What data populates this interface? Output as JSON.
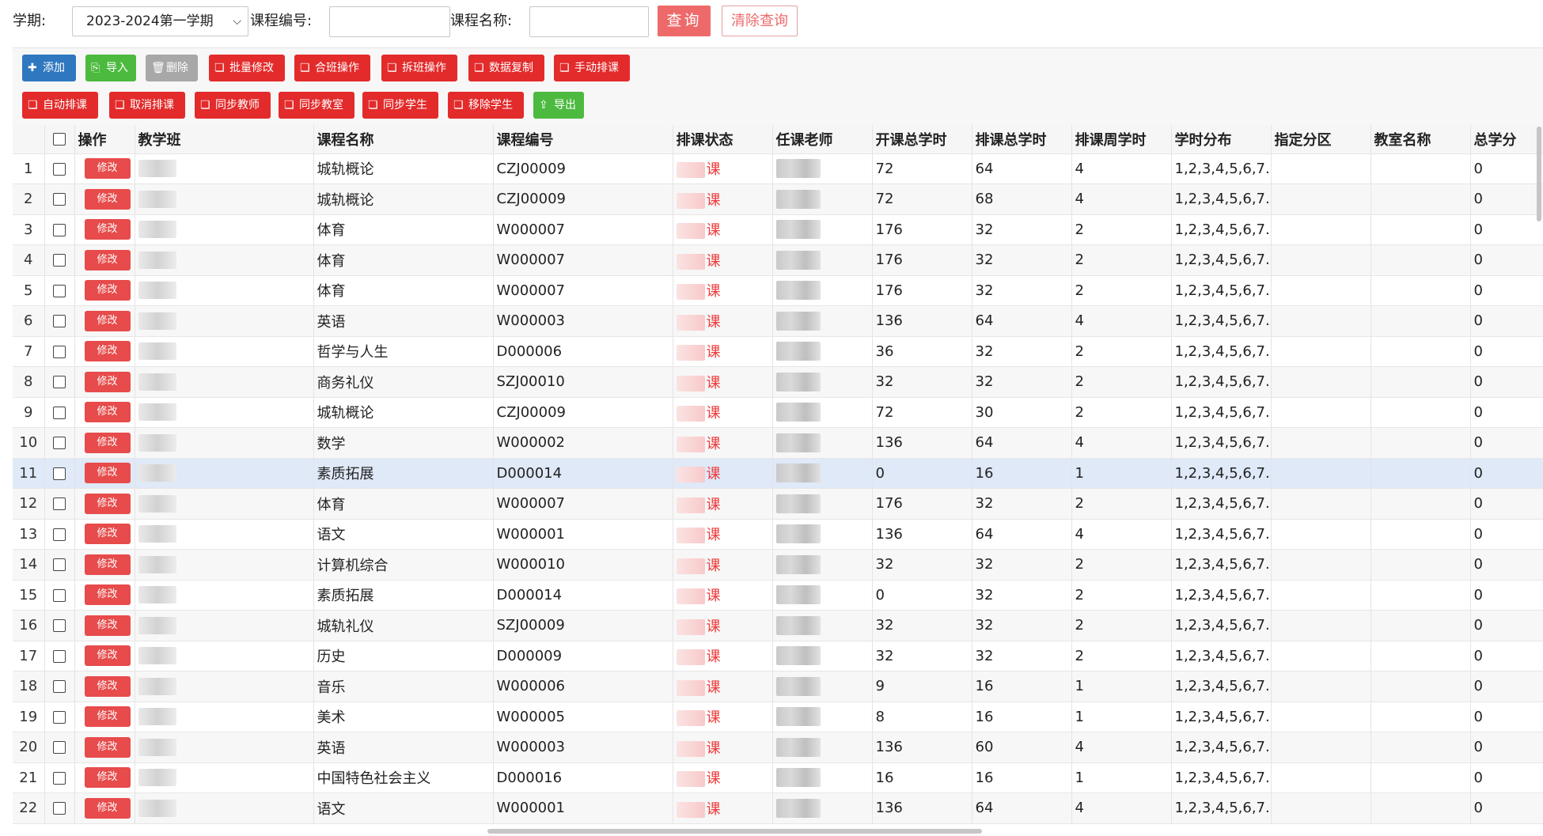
{
  "search": {
    "term_label": "学期:",
    "term_value": "2023-2024第一学期",
    "course_code_label": "课程编号:",
    "course_code_value": "",
    "course_name_label": "课程名称:",
    "course_name_value": "",
    "query_button": "查询",
    "clear_button": "清除查询"
  },
  "toolbar": {
    "row1": [
      {
        "label": "添加",
        "color": "blue",
        "icon": "plus-icon"
      },
      {
        "label": "导入",
        "color": "green",
        "icon": "import-icon"
      },
      {
        "label": "删除",
        "color": "gray",
        "icon": "trash-icon"
      },
      {
        "label": "批量修改",
        "color": "red",
        "icon": "book-icon"
      },
      {
        "label": "合班操作",
        "color": "red",
        "icon": "book-icon"
      },
      {
        "label": "拆班操作",
        "color": "red",
        "icon": "book-icon"
      },
      {
        "label": "数据复制",
        "color": "red",
        "icon": "book-icon"
      },
      {
        "label": "手动排课",
        "color": "red",
        "icon": "book-icon"
      }
    ],
    "row2": [
      {
        "label": "自动排课",
        "color": "red",
        "icon": "book-icon"
      },
      {
        "label": "取消排课",
        "color": "red",
        "icon": "book-icon"
      },
      {
        "label": "同步教师",
        "color": "red",
        "icon": "book-icon"
      },
      {
        "label": "同步教室",
        "color": "red",
        "icon": "book-icon"
      },
      {
        "label": "同步学生",
        "color": "red",
        "icon": "book-icon"
      },
      {
        "label": "移除学生",
        "color": "red",
        "icon": "book-icon"
      },
      {
        "label": "导出",
        "color": "green",
        "icon": "export-icon"
      }
    ]
  },
  "table": {
    "columns": [
      "操作",
      "教学班",
      "课程名称",
      "课程编号",
      "排课状态",
      "任课老师",
      "开课总学时",
      "排课总学时",
      "排课周学时",
      "学时分布",
      "指定分区",
      "教室名称",
      "总学分"
    ],
    "edit_label": "修改",
    "status_suffix": "课",
    "selected_row": 11,
    "rows": [
      {
        "no": "1",
        "course": "城轨概论",
        "code": "CZJ00009",
        "total": "72",
        "sched": "64",
        "weekly": "4",
        "dist": "1,2,3,4,5,6,7...",
        "credit": "0"
      },
      {
        "no": "2",
        "course": "城轨概论",
        "code": "CZJ00009",
        "total": "72",
        "sched": "68",
        "weekly": "4",
        "dist": "1,2,3,4,5,6,7...",
        "credit": "0"
      },
      {
        "no": "3",
        "course": "体育",
        "code": "W000007",
        "total": "176",
        "sched": "32",
        "weekly": "2",
        "dist": "1,2,3,4,5,6,7...",
        "credit": "0"
      },
      {
        "no": "4",
        "course": "体育",
        "code": "W000007",
        "total": "176",
        "sched": "32",
        "weekly": "2",
        "dist": "1,2,3,4,5,6,7...",
        "credit": "0"
      },
      {
        "no": "5",
        "course": "体育",
        "code": "W000007",
        "total": "176",
        "sched": "32",
        "weekly": "2",
        "dist": "1,2,3,4,5,6,7...",
        "credit": "0"
      },
      {
        "no": "6",
        "course": "英语",
        "code": "W000003",
        "total": "136",
        "sched": "64",
        "weekly": "4",
        "dist": "1,2,3,4,5,6,7...",
        "credit": "0"
      },
      {
        "no": "7",
        "course": "哲学与人生",
        "code": "D000006",
        "total": "36",
        "sched": "32",
        "weekly": "2",
        "dist": "1,2,3,4,5,6,7...",
        "credit": "0"
      },
      {
        "no": "8",
        "course": "商务礼仪",
        "code": "SZJ00010",
        "total": "32",
        "sched": "32",
        "weekly": "2",
        "dist": "1,2,3,4,5,6,7...",
        "credit": "0"
      },
      {
        "no": "9",
        "course": "城轨概论",
        "code": "CZJ00009",
        "total": "72",
        "sched": "30",
        "weekly": "2",
        "dist": "1,2,3,4,5,6,7...",
        "credit": "0"
      },
      {
        "no": "10",
        "course": "数学",
        "code": "W000002",
        "total": "136",
        "sched": "64",
        "weekly": "4",
        "dist": "1,2,3,4,5,6,7...",
        "credit": "0"
      },
      {
        "no": "11",
        "course": "素质拓展",
        "code": "D000014",
        "total": "0",
        "sched": "16",
        "weekly": "1",
        "dist": "1,2,3,4,5,6,7...",
        "credit": "0"
      },
      {
        "no": "12",
        "course": "体育",
        "code": "W000007",
        "total": "176",
        "sched": "32",
        "weekly": "2",
        "dist": "1,2,3,4,5,6,7...",
        "credit": "0"
      },
      {
        "no": "13",
        "course": "语文",
        "code": "W000001",
        "total": "136",
        "sched": "64",
        "weekly": "4",
        "dist": "1,2,3,4,5,6,7...",
        "credit": "0"
      },
      {
        "no": "14",
        "course": "计算机综合",
        "code": "W000010",
        "total": "32",
        "sched": "32",
        "weekly": "2",
        "dist": "1,2,3,4,5,6,7...",
        "credit": "0"
      },
      {
        "no": "15",
        "course": "素质拓展",
        "code": "D000014",
        "total": "0",
        "sched": "32",
        "weekly": "2",
        "dist": "1,2,3,4,5,6,7...",
        "credit": "0"
      },
      {
        "no": "16",
        "course": "城轨礼仪",
        "code": "SZJ00009",
        "total": "32",
        "sched": "32",
        "weekly": "2",
        "dist": "1,2,3,4,5,6,7...",
        "credit": "0"
      },
      {
        "no": "17",
        "course": "历史",
        "code": "D000009",
        "total": "32",
        "sched": "32",
        "weekly": "2",
        "dist": "1,2,3,4,5,6,7...",
        "credit": "0"
      },
      {
        "no": "18",
        "course": "音乐",
        "code": "W000006",
        "total": "9",
        "sched": "16",
        "weekly": "1",
        "dist": "1,2,3,4,5,6,7...",
        "credit": "0"
      },
      {
        "no": "19",
        "course": "美术",
        "code": "W000005",
        "total": "8",
        "sched": "16",
        "weekly": "1",
        "dist": "1,2,3,4,5,6,7...",
        "credit": "0"
      },
      {
        "no": "20",
        "course": "英语",
        "code": "W000003",
        "total": "136",
        "sched": "60",
        "weekly": "4",
        "dist": "1,2,3,4,5,6,7...",
        "credit": "0"
      },
      {
        "no": "21",
        "course": "中国特色社会主义",
        "code": "D000016",
        "total": "16",
        "sched": "16",
        "weekly": "1",
        "dist": "1,2,3,4,5,6,7...",
        "credit": "0"
      },
      {
        "no": "22",
        "course": "语文",
        "code": "W000001",
        "total": "136",
        "sched": "64",
        "weekly": "4",
        "dist": "1,2,3,4,5,6,7...",
        "credit": "0"
      }
    ]
  }
}
